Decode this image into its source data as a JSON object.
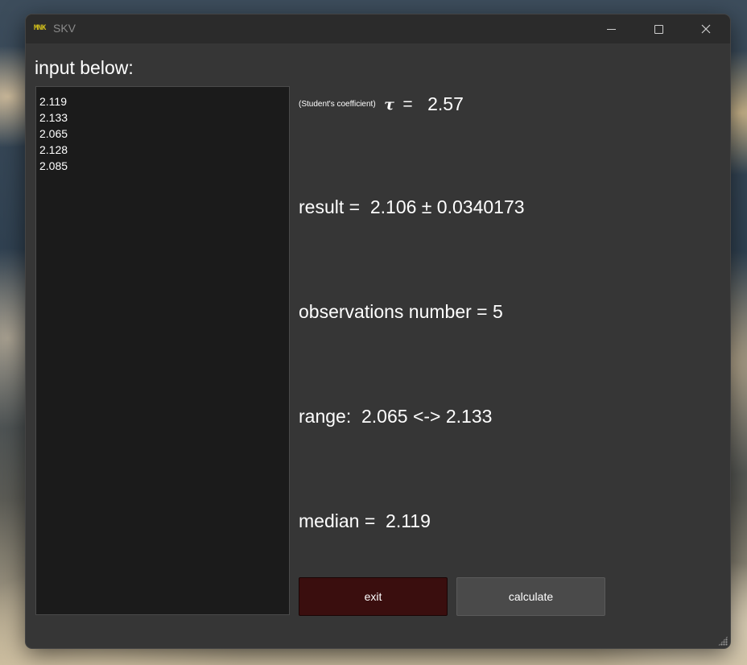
{
  "window": {
    "app_icon_text": "MNK",
    "title": "SKV"
  },
  "input": {
    "label": "input below:",
    "lines": [
      "2.119",
      "2.133",
      "2.065",
      "2.128",
      "2.085"
    ]
  },
  "tau": {
    "note": "(Student's coefficient)",
    "symbol": "τ",
    "equals": "=",
    "value": "2.57"
  },
  "stats": {
    "result": "result =  2.106 ± 0.0340173",
    "observations": "observations number = 5",
    "range": "range:  2.065 <-> 2.133",
    "median": "median =  2.119"
  },
  "buttons": {
    "exit": "exit",
    "calculate": "calculate"
  },
  "colors": {
    "window_bg": "#363636",
    "titlebar_bg": "#2b2b2b",
    "input_bg": "#1b1b1b",
    "exit_bg": "#3a0e0e",
    "calculate_bg": "#4a4a4a",
    "app_icon": "#d4c11b"
  }
}
